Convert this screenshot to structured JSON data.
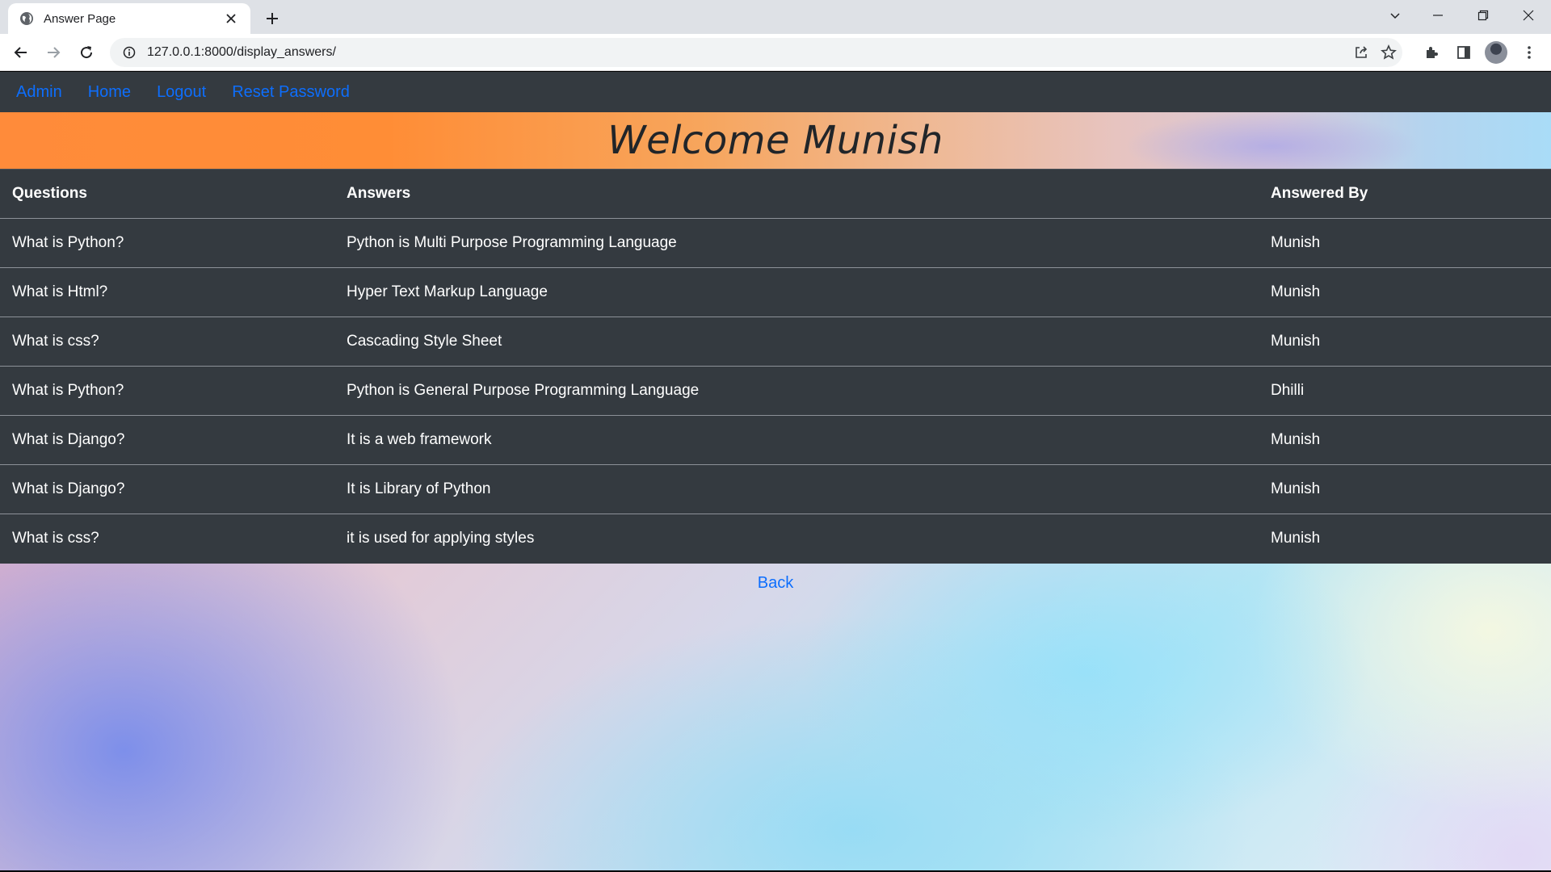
{
  "browser": {
    "tab_title": "Answer Page",
    "url": "127.0.0.1:8000/display_answers/"
  },
  "colors": {
    "navbar_bg": "#343a40",
    "link": "#0d6efd",
    "table_bg": "#343a40",
    "banner_start": "#ff8b3a",
    "banner_end": "#a9dcf7"
  },
  "nav": {
    "items": [
      {
        "label": "Admin"
      },
      {
        "label": "Home"
      },
      {
        "label": "Logout"
      },
      {
        "label": "Reset Password"
      }
    ]
  },
  "banner": {
    "title": "Welcome Munish"
  },
  "table": {
    "headers": [
      "Questions",
      "Answers",
      "Answered By"
    ],
    "rows": [
      {
        "question": "What is Python?",
        "answer": "Python is Multi Purpose Programming Language",
        "answered_by": "Munish"
      },
      {
        "question": "What is Html?",
        "answer": "Hyper Text Markup Language",
        "answered_by": "Munish"
      },
      {
        "question": "What is css?",
        "answer": "Cascading Style Sheet",
        "answered_by": "Munish"
      },
      {
        "question": "What is Python?",
        "answer": "Python is General Purpose Programming Language",
        "answered_by": "Dhilli"
      },
      {
        "question": "What is Django?",
        "answer": "It is a web framework",
        "answered_by": "Munish"
      },
      {
        "question": "What is Django?",
        "answer": "It is Library of Python",
        "answered_by": "Munish"
      },
      {
        "question": "What is css?",
        "answer": "it is used for applying styles",
        "answered_by": "Munish"
      }
    ]
  },
  "footer": {
    "back_label": "Back"
  },
  "icons": {
    "favicon": "globe-icon",
    "tab_close": "close-icon",
    "new_tab": "plus-icon",
    "back": "arrow-left-icon",
    "forward": "arrow-right-icon",
    "reload": "reload-icon",
    "site_info": "info-icon",
    "share": "share-icon",
    "bookmark": "star-icon",
    "extensions": "puzzle-icon",
    "side_panel": "side-panel-icon",
    "menu": "kebab-menu-icon"
  }
}
